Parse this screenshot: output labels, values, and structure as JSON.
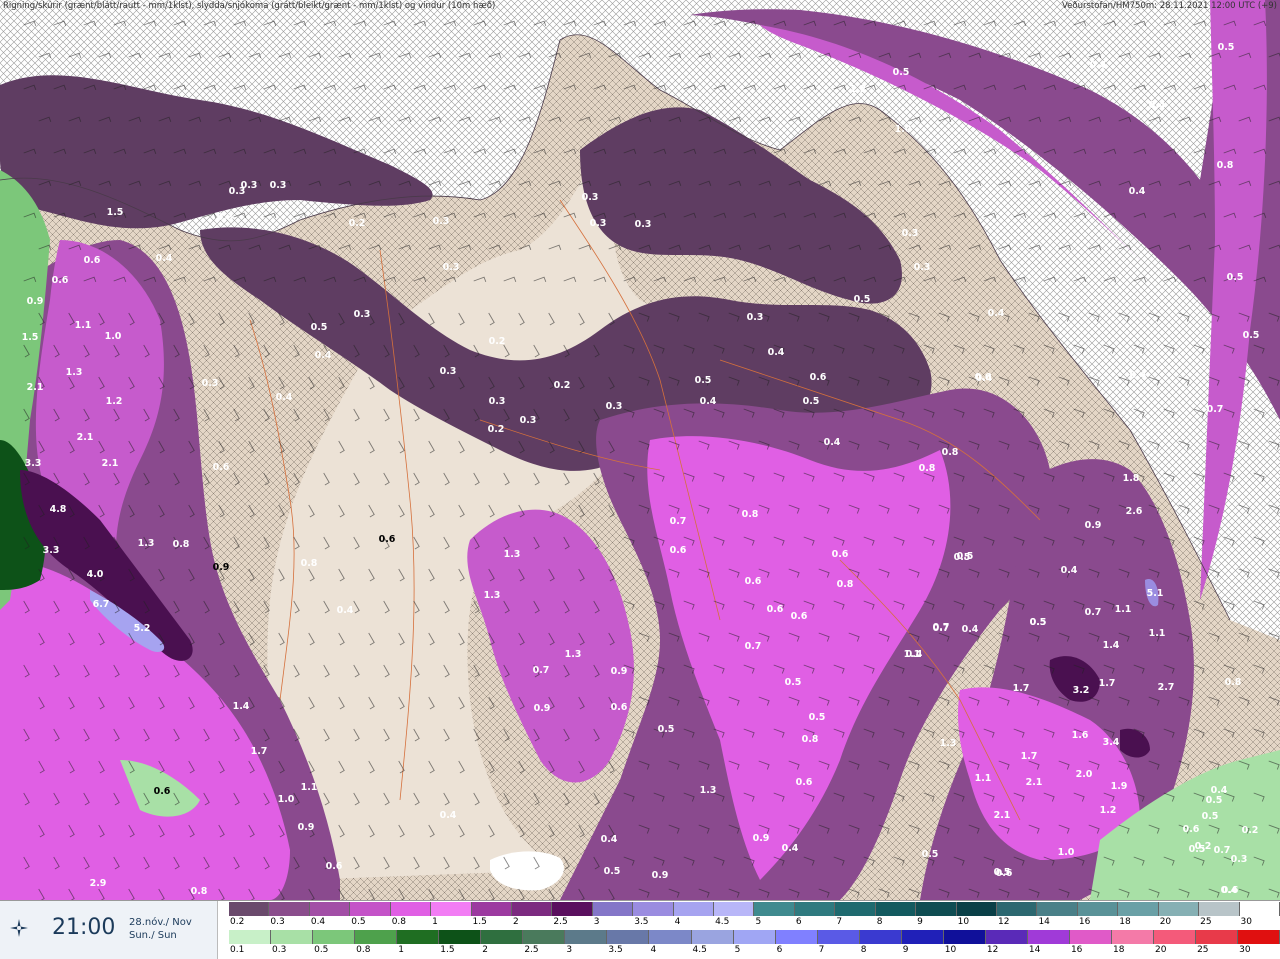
{
  "header": {
    "left": "Rigning/skúrir (grænt/blátt/rautt - mm/1klst), slydda/snjókoma (grátt/bleikt/grænt - mm/1klst) og vindur (10m hæð)",
    "right": "Veðurstofan/HM750m: 28.11.2021 12:00 UTC (+9)"
  },
  "time": {
    "clock": "21:00",
    "date_line1": "28.nóv./ Nov",
    "date_line2": "Sun./ Sun"
  },
  "icons": {
    "time": "compass-star-icon"
  },
  "colors": {
    "ocean_hatch": "#ffffff",
    "land": "#e9ddd0",
    "snow_dark": "#5f3d62",
    "snow_mid": "#8a4a8e",
    "snow_light": "#c65bcc",
    "snow_bright": "#f07cf2",
    "rain_light": "#a8e0a6",
    "rain_dark": "#0c5a1e"
  },
  "legend_top": {
    "labels": [
      "0.2",
      "0.3",
      "0.4",
      "0.5",
      "0.8",
      "1",
      "1.5",
      "2",
      "2.5",
      "3",
      "3.5",
      "4",
      "4.5",
      "5",
      "6",
      "7",
      "8",
      "9",
      "10",
      "12",
      "14",
      "16",
      "18",
      "20",
      "25",
      "30"
    ],
    "colors": [
      "#6a4a6c",
      "#8a4d8c",
      "#a24ea6",
      "#c453c8",
      "#e05fe4",
      "#f27df4",
      "#9c3aa0",
      "#7c2a80",
      "#5a0f5e",
      "#8476c8",
      "#9a8ce0",
      "#a6a3f0",
      "#b8b6f8",
      "#3f8a8f",
      "#2f7a7f",
      "#1f6a6f",
      "#135a5f",
      "#0f4d52",
      "#0a4047",
      "#2c6870",
      "#4a8088",
      "#5a9298",
      "#6aa0a6",
      "#86b0b4",
      "#b8c4c8",
      "#ffffff"
    ]
  },
  "legend_bottom": {
    "labels": [
      "0.1",
      "0.3",
      "0.5",
      "0.8",
      "1",
      "1.5",
      "2",
      "2.5",
      "3",
      "3.5",
      "4",
      "4.5",
      "5",
      "6",
      "7",
      "8",
      "9",
      "10",
      "12",
      "14",
      "16",
      "18",
      "20",
      "25",
      "30"
    ],
    "colors": [
      "#c8f0c8",
      "#a8e0a6",
      "#7cc77a",
      "#4ea14c",
      "#1f6e22",
      "#0d5218",
      "#2f6f3f",
      "#4a7a5c",
      "#5c7a8a",
      "#6878a8",
      "#7c88c8",
      "#9aa4e0",
      "#a0a6f4",
      "#8080ff",
      "#5a5ae6",
      "#3a3ad0",
      "#2020b8",
      "#10109a",
      "#5a2ab8",
      "#a03ad8",
      "#e05ac8",
      "#f47aa8",
      "#f45a7a",
      "#e83a4a",
      "#e01010"
    ]
  },
  "map_values": [
    {
      "v": "0.3",
      "c": "w"
    },
    {
      "v": "0.3",
      "c": "w"
    },
    {
      "v": "0.2",
      "c": "w"
    },
    {
      "v": "0.3",
      "c": "w"
    },
    {
      "v": "0.3",
      "c": "w"
    },
    {
      "v": "0.5",
      "c": "w"
    },
    {
      "v": "0.4",
      "c": "w"
    },
    {
      "v": "0.3",
      "c": "w"
    },
    {
      "v": "0.3",
      "c": "w"
    },
    {
      "v": "0.3",
      "c": "w"
    },
    {
      "v": "0.2",
      "c": "w"
    },
    {
      "v": "0.3",
      "c": "w"
    },
    {
      "v": "0.3",
      "c": "w"
    },
    {
      "v": "0.3",
      "c": "w"
    },
    {
      "v": "0.3",
      "c": "w"
    },
    {
      "v": "1.2",
      "c": "w"
    },
    {
      "v": "1.0",
      "c": "w"
    },
    {
      "v": "0.5",
      "c": "w"
    },
    {
      "v": "0.4",
      "c": "w"
    },
    {
      "v": "0.4",
      "c": "w"
    },
    {
      "v": "0.4",
      "c": "w"
    },
    {
      "v": "0.5",
      "c": "w"
    },
    {
      "v": "0.5",
      "c": "w"
    },
    {
      "v": "0.8",
      "c": "w"
    },
    {
      "v": "0.5",
      "c": "w"
    },
    {
      "v": "0.7",
      "c": "w"
    },
    {
      "v": "0.4",
      "c": "w"
    },
    {
      "v": "0.4",
      "c": "w"
    },
    {
      "v": "0.3",
      "c": "w"
    },
    {
      "v": "0.3",
      "c": "w"
    },
    {
      "v": "1.5",
      "c": "w"
    },
    {
      "v": "0.6",
      "c": "w"
    },
    {
      "v": "0.6",
      "c": "w"
    },
    {
      "v": "0.4",
      "c": "w"
    },
    {
      "v": "0.9",
      "c": "w"
    },
    {
      "v": "1.1",
      "c": "w"
    },
    {
      "v": "1.5",
      "c": "w"
    },
    {
      "v": "1.0",
      "c": "w"
    },
    {
      "v": "1.3",
      "c": "w"
    },
    {
      "v": "2.1",
      "c": "w"
    },
    {
      "v": "1.2",
      "c": "w"
    },
    {
      "v": "2.1",
      "c": "w"
    },
    {
      "v": "2.1",
      "c": "w"
    },
    {
      "v": "3.3",
      "c": "w"
    },
    {
      "v": "4.8",
      "c": "w"
    },
    {
      "v": "3.3",
      "c": "w"
    },
    {
      "v": "4.0",
      "c": "w"
    },
    {
      "v": "6.7",
      "c": "w"
    },
    {
      "v": "5.2",
      "c": "w"
    },
    {
      "v": "1.3",
      "c": "w"
    },
    {
      "v": "0.8",
      "c": "w"
    },
    {
      "v": "1.4",
      "c": "w"
    },
    {
      "v": "1.7",
      "c": "w"
    },
    {
      "v": "1.1",
      "c": "w"
    },
    {
      "v": "1.0",
      "c": "w"
    },
    {
      "v": "0.9",
      "c": "w"
    },
    {
      "v": "0.6",
      "c": "w"
    },
    {
      "v": "2.9",
      "c": "w"
    },
    {
      "v": "0.8",
      "c": "w"
    },
    {
      "v": "0.6",
      "c": "d"
    },
    {
      "v": "0.9",
      "c": "d"
    },
    {
      "v": "0.6",
      "c": "d"
    },
    {
      "v": "0.8",
      "c": "w"
    },
    {
      "v": "0.4",
      "c": "w"
    },
    {
      "v": "0.6",
      "c": "w"
    },
    {
      "v": "0.4",
      "c": "w"
    },
    {
      "v": "0.3",
      "c": "w"
    },
    {
      "v": "0.3",
      "c": "w"
    },
    {
      "v": "0.2",
      "c": "w"
    },
    {
      "v": "0.3",
      "c": "w"
    },
    {
      "v": "0.2",
      "c": "w"
    },
    {
      "v": "0.3",
      "c": "w"
    },
    {
      "v": "0.5",
      "c": "w"
    },
    {
      "v": "0.4",
      "c": "w"
    },
    {
      "v": "0.6",
      "c": "w"
    },
    {
      "v": "0.5",
      "c": "w"
    },
    {
      "v": "0.3",
      "c": "w"
    },
    {
      "v": "0.4",
      "c": "w"
    },
    {
      "v": "0.5",
      "c": "w"
    },
    {
      "v": "0.6",
      "c": "w"
    },
    {
      "v": "0.4",
      "c": "w"
    },
    {
      "v": "0.8",
      "c": "w"
    },
    {
      "v": "0.8",
      "c": "w"
    },
    {
      "v": "0.8",
      "c": "w"
    },
    {
      "v": "0.7",
      "c": "w"
    },
    {
      "v": "0.8",
      "c": "w"
    },
    {
      "v": "0.6",
      "c": "w"
    },
    {
      "v": "0.5",
      "c": "w"
    },
    {
      "v": "0.6",
      "c": "w"
    },
    {
      "v": "0.6",
      "c": "w"
    },
    {
      "v": "0.6",
      "c": "w"
    },
    {
      "v": "0.7",
      "c": "w"
    },
    {
      "v": "0.5",
      "c": "w"
    },
    {
      "v": "0.5",
      "c": "w"
    },
    {
      "v": "0.8",
      "c": "w"
    },
    {
      "v": "0.6",
      "c": "w"
    },
    {
      "v": "0.6",
      "c": "w"
    },
    {
      "v": "0.7",
      "c": "w"
    },
    {
      "v": "1.1",
      "c": "w"
    },
    {
      "v": "1.3",
      "c": "w"
    },
    {
      "v": "1.3",
      "c": "w"
    },
    {
      "v": "1.3",
      "c": "w"
    },
    {
      "v": "1.3",
      "c": "w"
    },
    {
      "v": "0.7",
      "c": "w"
    },
    {
      "v": "0.9",
      "c": "w"
    },
    {
      "v": "0.9",
      "c": "w"
    },
    {
      "v": "0.6",
      "c": "w"
    },
    {
      "v": "0.5",
      "c": "w"
    },
    {
      "v": "0.9",
      "c": "w"
    },
    {
      "v": "0.4",
      "c": "w"
    },
    {
      "v": "0.4",
      "c": "w"
    },
    {
      "v": "0.5",
      "c": "w"
    },
    {
      "v": "0.9",
      "c": "w"
    },
    {
      "v": "0.5",
      "c": "w"
    },
    {
      "v": "0.6",
      "c": "w"
    },
    {
      "v": "0.5",
      "c": "w"
    },
    {
      "v": "1.3",
      "c": "w"
    },
    {
      "v": "1.1",
      "c": "w"
    },
    {
      "v": "2.1",
      "c": "w"
    },
    {
      "v": "1.7",
      "c": "w"
    },
    {
      "v": "2.1",
      "c": "w"
    },
    {
      "v": "1.6",
      "c": "w"
    },
    {
      "v": "3.4",
      "c": "w"
    },
    {
      "v": "2.0",
      "c": "w"
    },
    {
      "v": "1.9",
      "c": "w"
    },
    {
      "v": "1.2",
      "c": "w"
    },
    {
      "v": "1.0",
      "c": "w"
    },
    {
      "v": "3.2",
      "c": "w"
    },
    {
      "v": "1.7",
      "c": "w"
    },
    {
      "v": "2.7",
      "c": "w"
    },
    {
      "v": "1.7",
      "c": "w"
    },
    {
      "v": "1.4",
      "c": "w"
    },
    {
      "v": "1.1",
      "c": "w"
    },
    {
      "v": "0.7",
      "c": "w"
    },
    {
      "v": "0.5",
      "c": "w"
    },
    {
      "v": "0.4",
      "c": "w"
    },
    {
      "v": "1.8",
      "c": "w"
    },
    {
      "v": "2.6",
      "c": "w"
    },
    {
      "v": "0.9",
      "c": "w"
    },
    {
      "v": "5.1",
      "c": "w"
    },
    {
      "v": "1.1",
      "c": "w"
    },
    {
      "v": "0.5",
      "c": "w"
    },
    {
      "v": "0.7",
      "c": "w"
    },
    {
      "v": "0.4",
      "c": "w"
    },
    {
      "v": "0.4",
      "c": "w"
    },
    {
      "v": "0.4",
      "c": "w"
    },
    {
      "v": "0.5",
      "c": "w"
    },
    {
      "v": "0.5",
      "c": "w"
    },
    {
      "v": "0.8",
      "c": "w"
    },
    {
      "v": "0.5",
      "c": "w"
    },
    {
      "v": "0.4",
      "c": "w"
    },
    {
      "v": "0.7",
      "c": "w"
    },
    {
      "v": "0.5",
      "c": "w"
    },
    {
      "v": "0.3",
      "c": "w"
    },
    {
      "v": "0.2",
      "c": "w"
    },
    {
      "v": "0.4",
      "c": "w"
    },
    {
      "v": "0.2",
      "c": "w"
    },
    {
      "v": "0.6",
      "c": "w"
    },
    {
      "v": "0.4",
      "c": "w"
    },
    {
      "v": "0.6",
      "c": "w"
    }
  ]
}
